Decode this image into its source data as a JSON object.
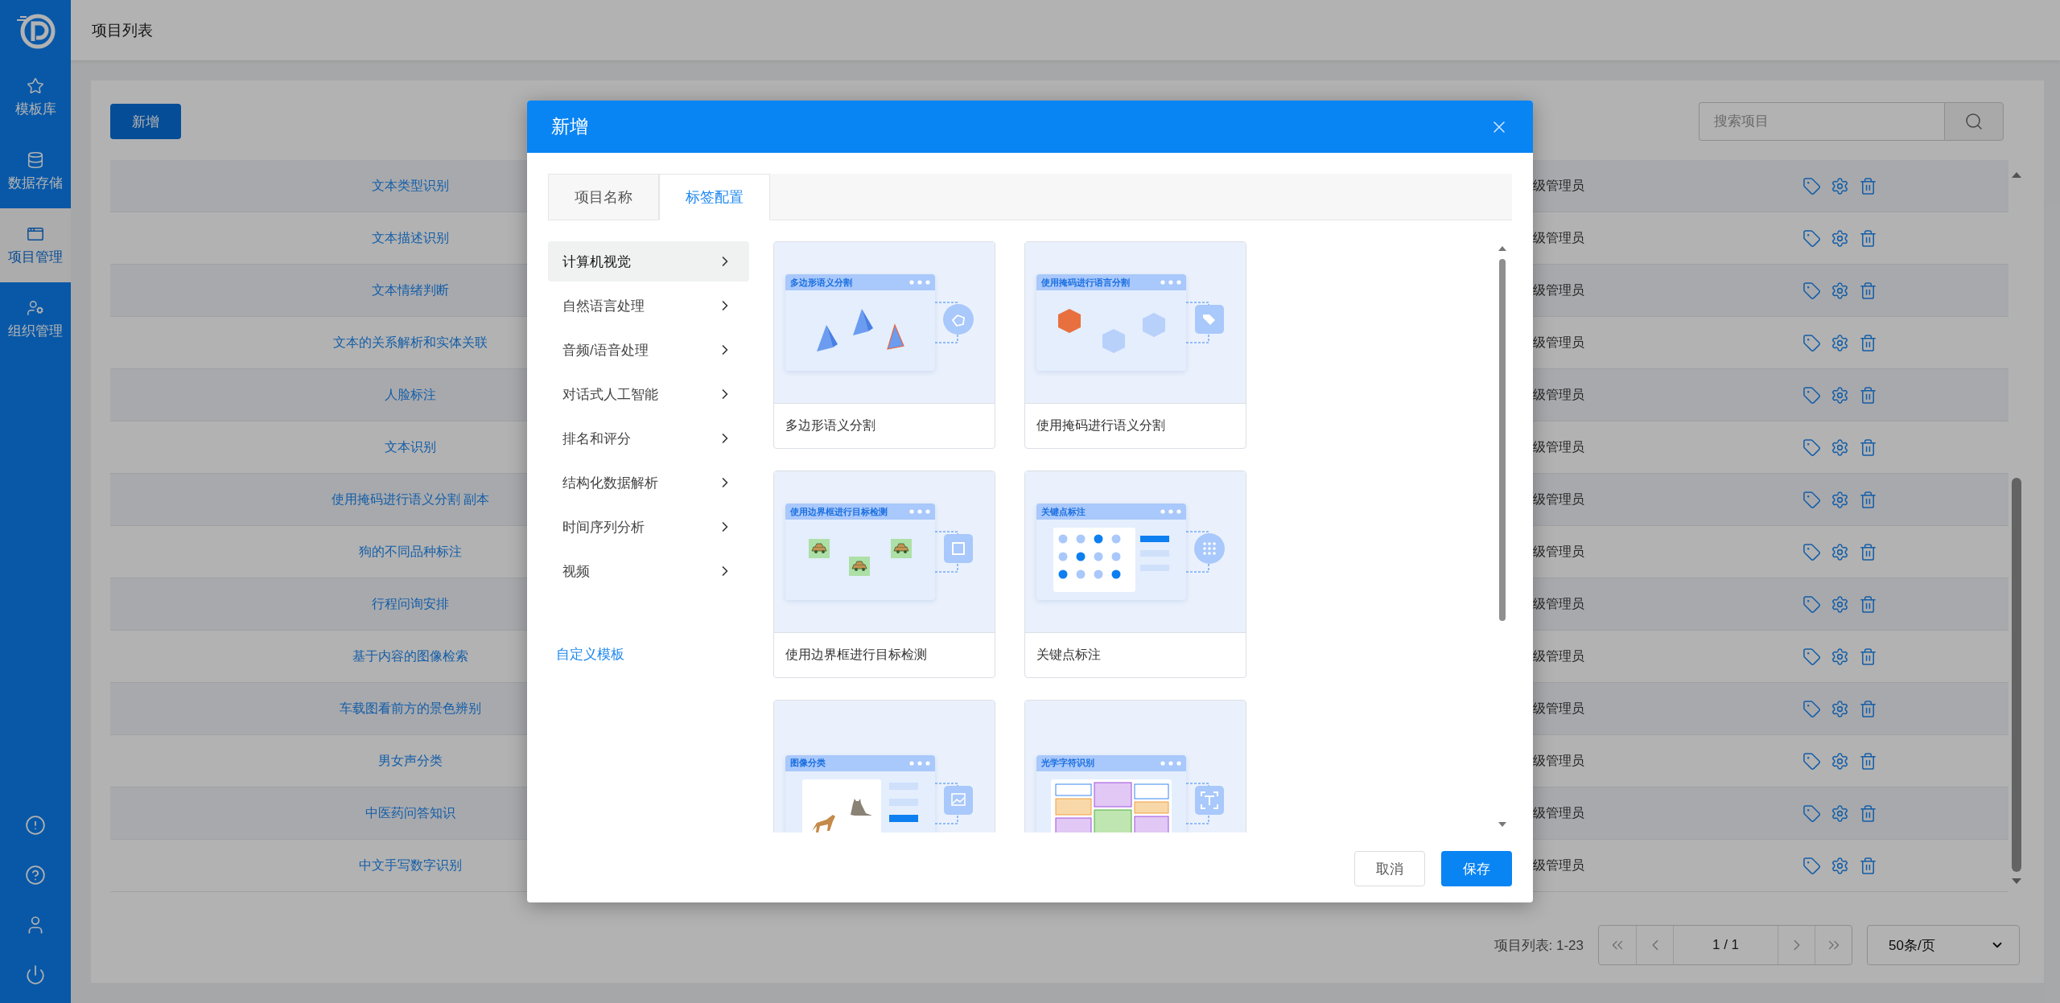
{
  "sidebar": {
    "items": [
      {
        "label": "模板库",
        "selected": false
      },
      {
        "label": "数据存储",
        "selected": false
      },
      {
        "label": "项目管理",
        "selected": true
      },
      {
        "label": "组织管理",
        "selected": false
      }
    ]
  },
  "header": {
    "title": "项目列表"
  },
  "toolbar": {
    "add_button": "新增",
    "search": {
      "placeholder": "搜索项目"
    }
  },
  "table": {
    "rows": [
      {
        "name": "文本类型识别",
        "role": "级管理员"
      },
      {
        "name": "文本描述识别",
        "role": "级管理员"
      },
      {
        "name": "文本情绪判断",
        "role": "级管理员"
      },
      {
        "name": "文本的关系解析和实体关联",
        "role": "级管理员"
      },
      {
        "name": "人脸标注",
        "role": "级管理员"
      },
      {
        "name": "文本识别",
        "role": "级管理员"
      },
      {
        "name": "使用掩码进行语义分割 副本",
        "role": "级管理员"
      },
      {
        "name": "狗的不同品种标注",
        "role": "级管理员"
      },
      {
        "name": "行程问询安排",
        "role": "级管理员"
      },
      {
        "name": "基于内容的图像检索",
        "role": "级管理员"
      },
      {
        "name": "车载图看前方的景色辨别",
        "role": "级管理员"
      },
      {
        "name": "男女声分类",
        "role": "级管理员"
      },
      {
        "name": "中医药问答知识",
        "role": "级管理员"
      },
      {
        "name": "中文手写数字识别",
        "role": "级管理员"
      }
    ]
  },
  "pagination": {
    "summary": "项目列表: 1-23",
    "page_display": "1 / 1",
    "page_size": "50条/页"
  },
  "modal": {
    "title": "新增",
    "tabs": [
      {
        "label": "项目名称",
        "selected": false
      },
      {
        "label": "标签配置",
        "selected": true
      }
    ],
    "categories": [
      {
        "label": "计算机视觉",
        "selected": true
      },
      {
        "label": "自然语言处理",
        "selected": false
      },
      {
        "label": "音频/语音处理",
        "selected": false
      },
      {
        "label": "对话式人工智能",
        "selected": false
      },
      {
        "label": "排名和评分",
        "selected": false
      },
      {
        "label": "结构化数据解析",
        "selected": false
      },
      {
        "label": "时间序列分析",
        "selected": false
      },
      {
        "label": "视频",
        "selected": false
      }
    ],
    "custom_template_link": "自定义模板",
    "templates": [
      {
        "kind": "polygon",
        "banner": "多边形语义分割",
        "title": "多边形语义分割"
      },
      {
        "kind": "mask",
        "banner": "使用掩码进行语言分割",
        "title": "使用掩码进行语义分割"
      },
      {
        "kind": "bbox",
        "banner": "使用边界框进行目标检测",
        "title": "使用边界框进行目标检测"
      },
      {
        "kind": "keypoint",
        "banner": "关键点标注",
        "title": "关键点标注"
      },
      {
        "kind": "classification",
        "banner": "图像分类"
      },
      {
        "kind": "ocr",
        "banner": "光学字符识别"
      }
    ],
    "buttons": {
      "cancel": "取消",
      "save": "保存"
    }
  }
}
